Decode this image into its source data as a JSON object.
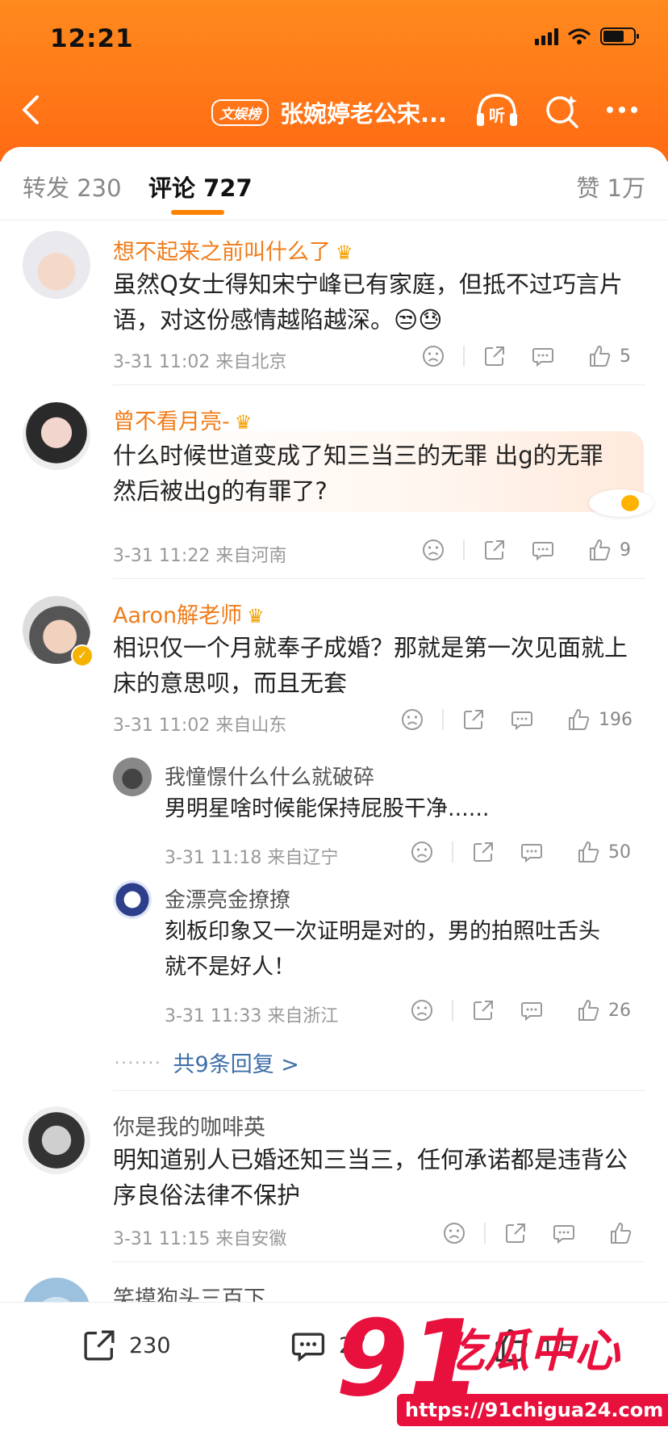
{
  "status_bar": {
    "time": "12:21"
  },
  "header": {
    "badge": "文娱榜",
    "title": "张婉婷老公宋..."
  },
  "tabs": {
    "repost": "转发 230",
    "comments": "评论 727",
    "likes": "赞 1万"
  },
  "comments": [
    {
      "user": "想不起来之前叫什么了",
      "text_line1": "虽然Q女士得知宋宁峰已有家庭，但抵不过巧言片",
      "text_line2": "语，对这份感情越陷越深。😒😓",
      "meta": "3-31 11:02 来自北京",
      "likes": "5"
    },
    {
      "user": "曾不看月亮-",
      "text_line1": "什么时候世道变成了知三当三的无罪 出g的无罪",
      "text_line2": "然后被出g的有罪了?",
      "meta": "3-31 11:22 来自河南",
      "likes": "9"
    },
    {
      "user": "Aaron解老师",
      "text_line1": "相识仅一个月就奉子成婚？那就是第一次见面就上",
      "text_line2": "床的意思呗，而且无套",
      "meta": "3-31 11:02 来自山东",
      "likes": "196",
      "replies": [
        {
          "user": "我憧憬什么什么就破碎",
          "text_line1": "男明星啥时候能保持屁股干净......",
          "text_line2": "",
          "meta": "3-31 11:18 来自辽宁",
          "likes": "50"
        },
        {
          "user": "金漂亮金撩撩",
          "text_line1": "刻板印象又一次证明是对的，男的拍照吐舌头",
          "text_line2": "就不是好人！",
          "meta": "3-31 11:33 来自浙江",
          "likes": "26"
        }
      ],
      "more_replies": "共9条回复 >"
    },
    {
      "user": "你是我的咖啡英",
      "text_line1": "明知道别人已婚还知三当三，任何承诺都是违背公",
      "text_line2": "序良俗法律不保护",
      "meta": "3-31 11:15 来自安徽",
      "likes": ""
    },
    {
      "user": "笑摸狗头三百下"
    }
  ],
  "bottom_bar": {
    "repost_count": "230",
    "comment_count": "27",
    "like_count": "1万"
  },
  "watermark": {
    "number": "91",
    "name": "吃瓜中心",
    "url": "https://91chigua24.com"
  },
  "colors": {
    "header_orange": "#ff7a18",
    "vip_name": "#f07c1a",
    "link_blue": "#3d6ea8",
    "tab_underline": "#ff8200",
    "watermark_red": "#e8113d"
  }
}
